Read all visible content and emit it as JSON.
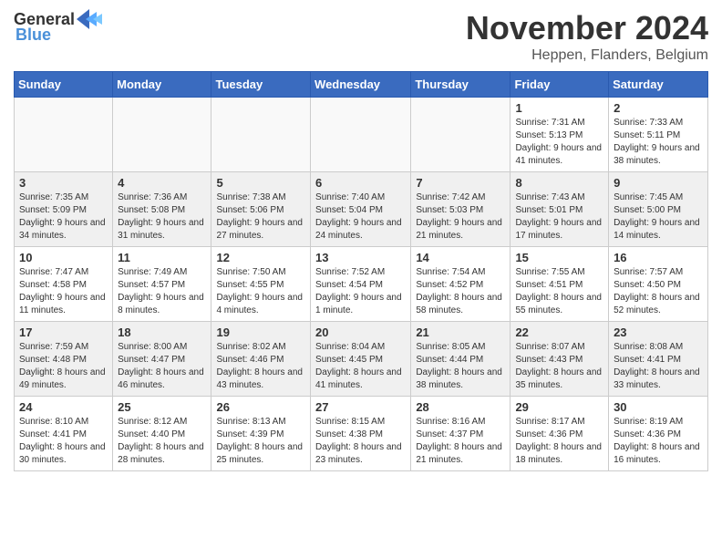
{
  "logo": {
    "general": "General",
    "blue": "Blue"
  },
  "title": {
    "month_year": "November 2024",
    "location": "Heppen, Flanders, Belgium"
  },
  "calendar": {
    "headers": [
      "Sunday",
      "Monday",
      "Tuesday",
      "Wednesday",
      "Thursday",
      "Friday",
      "Saturday"
    ],
    "weeks": [
      [
        {
          "day": "",
          "info": ""
        },
        {
          "day": "",
          "info": ""
        },
        {
          "day": "",
          "info": ""
        },
        {
          "day": "",
          "info": ""
        },
        {
          "day": "",
          "info": ""
        },
        {
          "day": "1",
          "info": "Sunrise: 7:31 AM\nSunset: 5:13 PM\nDaylight: 9 hours and 41 minutes."
        },
        {
          "day": "2",
          "info": "Sunrise: 7:33 AM\nSunset: 5:11 PM\nDaylight: 9 hours and 38 minutes."
        }
      ],
      [
        {
          "day": "3",
          "info": "Sunrise: 7:35 AM\nSunset: 5:09 PM\nDaylight: 9 hours and 34 minutes."
        },
        {
          "day": "4",
          "info": "Sunrise: 7:36 AM\nSunset: 5:08 PM\nDaylight: 9 hours and 31 minutes."
        },
        {
          "day": "5",
          "info": "Sunrise: 7:38 AM\nSunset: 5:06 PM\nDaylight: 9 hours and 27 minutes."
        },
        {
          "day": "6",
          "info": "Sunrise: 7:40 AM\nSunset: 5:04 PM\nDaylight: 9 hours and 24 minutes."
        },
        {
          "day": "7",
          "info": "Sunrise: 7:42 AM\nSunset: 5:03 PM\nDaylight: 9 hours and 21 minutes."
        },
        {
          "day": "8",
          "info": "Sunrise: 7:43 AM\nSunset: 5:01 PM\nDaylight: 9 hours and 17 minutes."
        },
        {
          "day": "9",
          "info": "Sunrise: 7:45 AM\nSunset: 5:00 PM\nDaylight: 9 hours and 14 minutes."
        }
      ],
      [
        {
          "day": "10",
          "info": "Sunrise: 7:47 AM\nSunset: 4:58 PM\nDaylight: 9 hours and 11 minutes."
        },
        {
          "day": "11",
          "info": "Sunrise: 7:49 AM\nSunset: 4:57 PM\nDaylight: 9 hours and 8 minutes."
        },
        {
          "day": "12",
          "info": "Sunrise: 7:50 AM\nSunset: 4:55 PM\nDaylight: 9 hours and 4 minutes."
        },
        {
          "day": "13",
          "info": "Sunrise: 7:52 AM\nSunset: 4:54 PM\nDaylight: 9 hours and 1 minute."
        },
        {
          "day": "14",
          "info": "Sunrise: 7:54 AM\nSunset: 4:52 PM\nDaylight: 8 hours and 58 minutes."
        },
        {
          "day": "15",
          "info": "Sunrise: 7:55 AM\nSunset: 4:51 PM\nDaylight: 8 hours and 55 minutes."
        },
        {
          "day": "16",
          "info": "Sunrise: 7:57 AM\nSunset: 4:50 PM\nDaylight: 8 hours and 52 minutes."
        }
      ],
      [
        {
          "day": "17",
          "info": "Sunrise: 7:59 AM\nSunset: 4:48 PM\nDaylight: 8 hours and 49 minutes."
        },
        {
          "day": "18",
          "info": "Sunrise: 8:00 AM\nSunset: 4:47 PM\nDaylight: 8 hours and 46 minutes."
        },
        {
          "day": "19",
          "info": "Sunrise: 8:02 AM\nSunset: 4:46 PM\nDaylight: 8 hours and 43 minutes."
        },
        {
          "day": "20",
          "info": "Sunrise: 8:04 AM\nSunset: 4:45 PM\nDaylight: 8 hours and 41 minutes."
        },
        {
          "day": "21",
          "info": "Sunrise: 8:05 AM\nSunset: 4:44 PM\nDaylight: 8 hours and 38 minutes."
        },
        {
          "day": "22",
          "info": "Sunrise: 8:07 AM\nSunset: 4:43 PM\nDaylight: 8 hours and 35 minutes."
        },
        {
          "day": "23",
          "info": "Sunrise: 8:08 AM\nSunset: 4:41 PM\nDaylight: 8 hours and 33 minutes."
        }
      ],
      [
        {
          "day": "24",
          "info": "Sunrise: 8:10 AM\nSunset: 4:41 PM\nDaylight: 8 hours and 30 minutes."
        },
        {
          "day": "25",
          "info": "Sunrise: 8:12 AM\nSunset: 4:40 PM\nDaylight: 8 hours and 28 minutes."
        },
        {
          "day": "26",
          "info": "Sunrise: 8:13 AM\nSunset: 4:39 PM\nDaylight: 8 hours and 25 minutes."
        },
        {
          "day": "27",
          "info": "Sunrise: 8:15 AM\nSunset: 4:38 PM\nDaylight: 8 hours and 23 minutes."
        },
        {
          "day": "28",
          "info": "Sunrise: 8:16 AM\nSunset: 4:37 PM\nDaylight: 8 hours and 21 minutes."
        },
        {
          "day": "29",
          "info": "Sunrise: 8:17 AM\nSunset: 4:36 PM\nDaylight: 8 hours and 18 minutes."
        },
        {
          "day": "30",
          "info": "Sunrise: 8:19 AM\nSunset: 4:36 PM\nDaylight: 8 hours and 16 minutes."
        }
      ]
    ]
  }
}
